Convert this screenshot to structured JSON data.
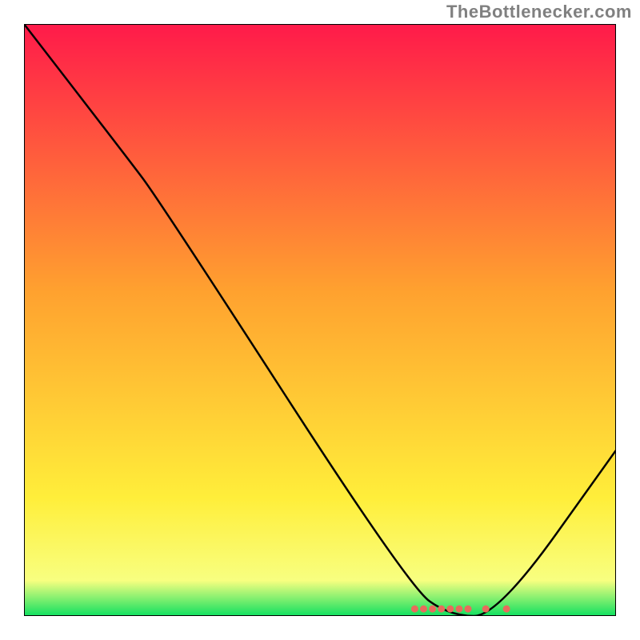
{
  "watermark": "TheBottlenecker.com",
  "chart_data": {
    "type": "line",
    "title": "",
    "xlabel": "",
    "ylabel": "",
    "xlim": [
      0,
      100
    ],
    "ylim": [
      0,
      100
    ],
    "gradient_stops": [
      {
        "offset": 0.0,
        "color": "#ff1a4a"
      },
      {
        "offset": 0.45,
        "color": "#ffa12f"
      },
      {
        "offset": 0.8,
        "color": "#ffee3a"
      },
      {
        "offset": 0.94,
        "color": "#f8ff80"
      },
      {
        "offset": 1.0,
        "color": "#10e060"
      }
    ],
    "curve": [
      {
        "x": 0,
        "y": 100
      },
      {
        "x": 17,
        "y": 78
      },
      {
        "x": 23,
        "y": 70
      },
      {
        "x": 65,
        "y": 5
      },
      {
        "x": 72,
        "y": 0
      },
      {
        "x": 80,
        "y": 0
      },
      {
        "x": 100,
        "y": 28
      }
    ],
    "markers": [
      {
        "x": 66,
        "y": 1.2
      },
      {
        "x": 67.5,
        "y": 1.2
      },
      {
        "x": 69,
        "y": 1.2
      },
      {
        "x": 70.5,
        "y": 1.2
      },
      {
        "x": 72,
        "y": 1.2
      },
      {
        "x": 73.5,
        "y": 1.2
      },
      {
        "x": 75,
        "y": 1.2
      },
      {
        "x": 78,
        "y": 1.2
      },
      {
        "x": 81.5,
        "y": 1.2
      }
    ],
    "marker_color": "#e86b5c",
    "curve_color": "#000000",
    "border_color": "#000000"
  }
}
